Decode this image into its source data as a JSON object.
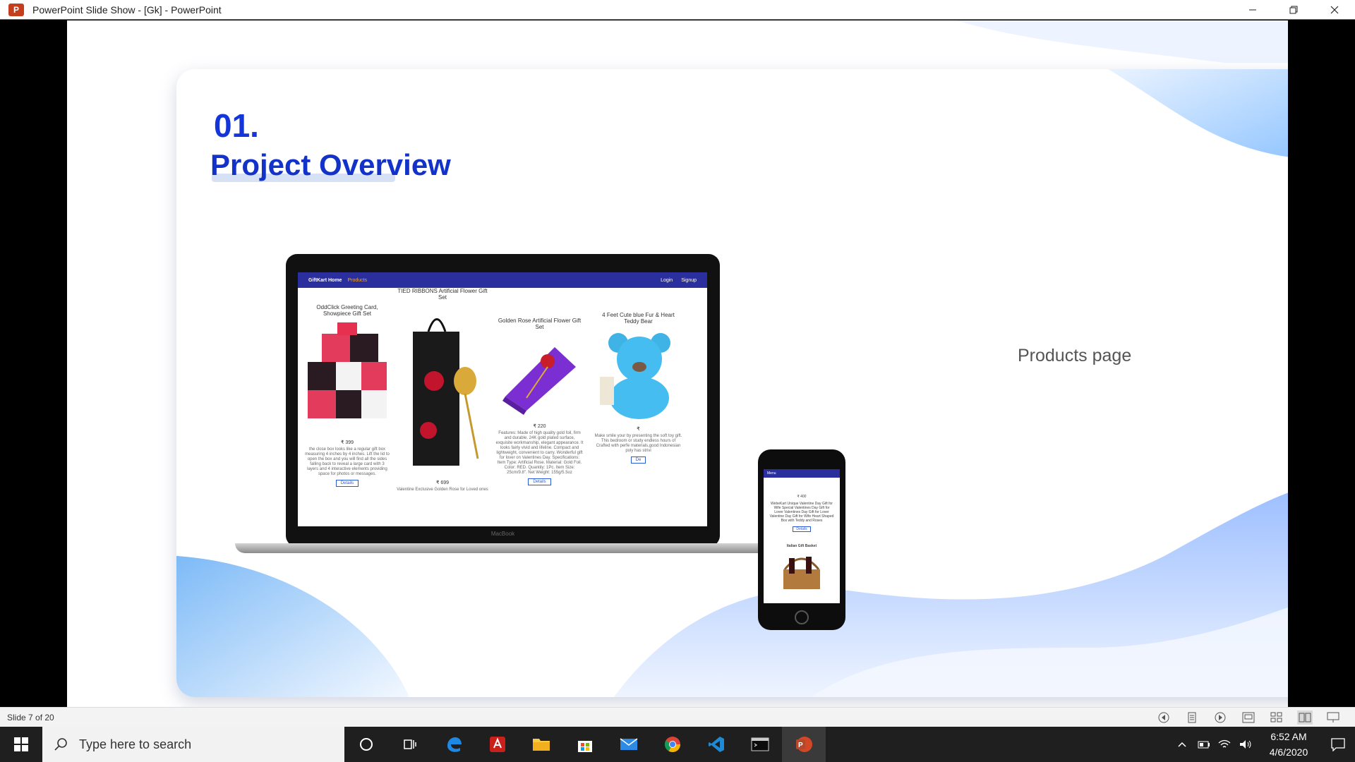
{
  "window": {
    "title": "PowerPoint Slide Show - [Gk] - PowerPoint",
    "logo_letter": "P",
    "controls": [
      "minimize-icon",
      "restore-icon",
      "close-icon"
    ]
  },
  "slide": {
    "number": "01.",
    "title": "Project Overview",
    "caption": "Products page",
    "accent_color": "#1436d8"
  },
  "laptop_mock": {
    "brand_label": "MacBook",
    "nav": {
      "brand": "GiftKart Home",
      "active": "Products",
      "login": "Login",
      "signup": "Signup"
    },
    "products": [
      {
        "name": "OddClick Greeting Card, Showpiece Gift Set",
        "price": "₹ 399",
        "description": "the close box looks like a regular gift box measuring 4 inches by 4 inches. Lift the lid to open the box and you will find all the sides falling back to reveal a large card with 3 layers and 4 interactive elements providing space for photos or messages.",
        "button": "Details"
      },
      {
        "name": "TIED RIBBONS Artificial Flower Gift Set",
        "price": "₹ 699",
        "description": "Valentine Exclusive Golden Rose for Loved ones",
        "button": ""
      },
      {
        "name": "Golden Rose Artificial Flower Gift Set",
        "price": "₹ 220",
        "description": "Features: Made of high quality gold foil, firm and durable. 24K gold plated surface, exquisite workmanship, elegant appearance. It looks fairly vivid and lifeline. Compact and lightweight, convenient to carry. Wonderful gift for lover on Valentines Day. Specifications: Item Type: Artificial Rose. Material: Gold Foil. Color: RED. Quantity: 1Pc. Item Size: 25cm/9.8\". Net Weight: 155g/5.5oz",
        "button": "Details"
      },
      {
        "name": "4 Feet Cute blue Fur & Heart Teddy Bear",
        "price": "₹",
        "description": "Make smile your by presenting the soft toy gift. This bedroom or study endless hours of Crafted with perfe materials,good Indonesian poly has strivi",
        "button": "De"
      }
    ]
  },
  "phone_mock": {
    "menu": "Menu",
    "price": "₹ 400",
    "description": "WebeKart Unique Valentine Day Gift for Wife Special Valentines Day Gift for Lover Valentines Day Gift for Lover Valentine Day Gift for Wife Heart Shaped Box with Teddy and Roses",
    "button": "Details",
    "next_item": "Italian Gift Basket"
  },
  "statusbar": {
    "slide_counter": "Slide 7 of 20",
    "icons": [
      "previous-icon",
      "notes-icon",
      "next-icon",
      "normal-view-icon",
      "slide-sorter-icon",
      "reading-view-icon",
      "slideshow-icon"
    ]
  },
  "taskbar": {
    "search_placeholder": "Type here to search",
    "apps": [
      "cortana-icon",
      "task-view-icon",
      "edge-icon",
      "acrobat-icon",
      "file-explorer-icon",
      "store-icon",
      "mail-icon",
      "chrome-icon",
      "vscode-icon",
      "terminal-icon",
      "powerpoint-icon"
    ],
    "time": "6:52 AM",
    "date": "4/6/2020"
  }
}
